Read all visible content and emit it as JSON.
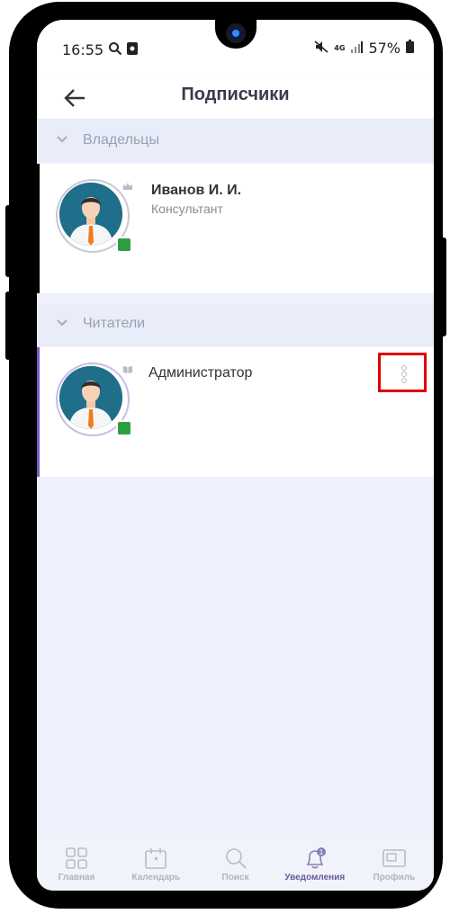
{
  "status_bar": {
    "time": "16:55",
    "network": "4G",
    "battery": "57%"
  },
  "header": {
    "title": "Подписчики"
  },
  "sections": [
    {
      "label": "Владельцы",
      "members": [
        {
          "name": "Иванов И. И.",
          "role": "Консультант",
          "badge": "crown-icon",
          "online": true
        }
      ]
    },
    {
      "label": "Читатели",
      "members": [
        {
          "name": "Администратор",
          "role": "",
          "badge": "book-icon",
          "online": true
        }
      ]
    }
  ],
  "bottom_nav": {
    "items": [
      {
        "label": "Главная",
        "icon": "grid-icon",
        "active": false
      },
      {
        "label": "Календарь",
        "icon": "calendar-icon",
        "active": false
      },
      {
        "label": "Поиск",
        "icon": "search-icon",
        "active": false
      },
      {
        "label": "Уведомления",
        "icon": "bell-icon",
        "active": true,
        "badge": "1"
      },
      {
        "label": "Профиль",
        "icon": "profile-card-icon",
        "active": false
      }
    ]
  },
  "colors": {
    "accent": "#7a5cc0",
    "online": "#2e9e42",
    "highlight": "#e00000"
  }
}
